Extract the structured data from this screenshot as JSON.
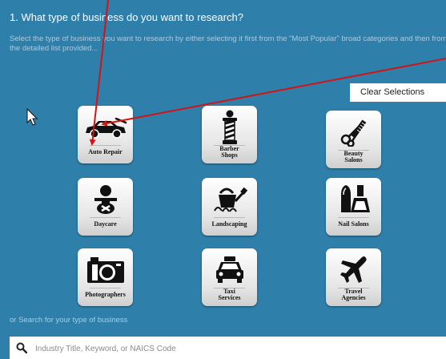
{
  "header": {
    "title": "1. What type of business do you want to research?",
    "description": "Select the type of business you want to research by either selecting it first from the \"Most Popular\" broad categories and then from the detailed list provided..."
  },
  "clear_button": {
    "label": "Clear Selections"
  },
  "tiles": [
    {
      "label": "Auto Repair",
      "icon": "car-icon"
    },
    {
      "label": "Barber\nShops",
      "icon": "barber-pole-icon"
    },
    {
      "label": "Beauty\nSalons",
      "icon": "scissors-comb-icon"
    },
    {
      "label": "Daycare",
      "icon": "baby-icon"
    },
    {
      "label": "Landscaping",
      "icon": "watering-can-icon"
    },
    {
      "label": "Nail Salons",
      "icon": "nail-polish-icon"
    },
    {
      "label": "Photographers",
      "icon": "camera-icon"
    },
    {
      "label": "Taxi\nServices",
      "icon": "taxi-icon"
    },
    {
      "label": "Travel\nAgencies",
      "icon": "airplane-icon"
    }
  ],
  "search": {
    "label": "or Search for your type of business",
    "placeholder": "Industry Title, Keyword, or NAICS Code"
  },
  "colors": {
    "panel": "#2f7fab",
    "arrow": "#d21414"
  }
}
